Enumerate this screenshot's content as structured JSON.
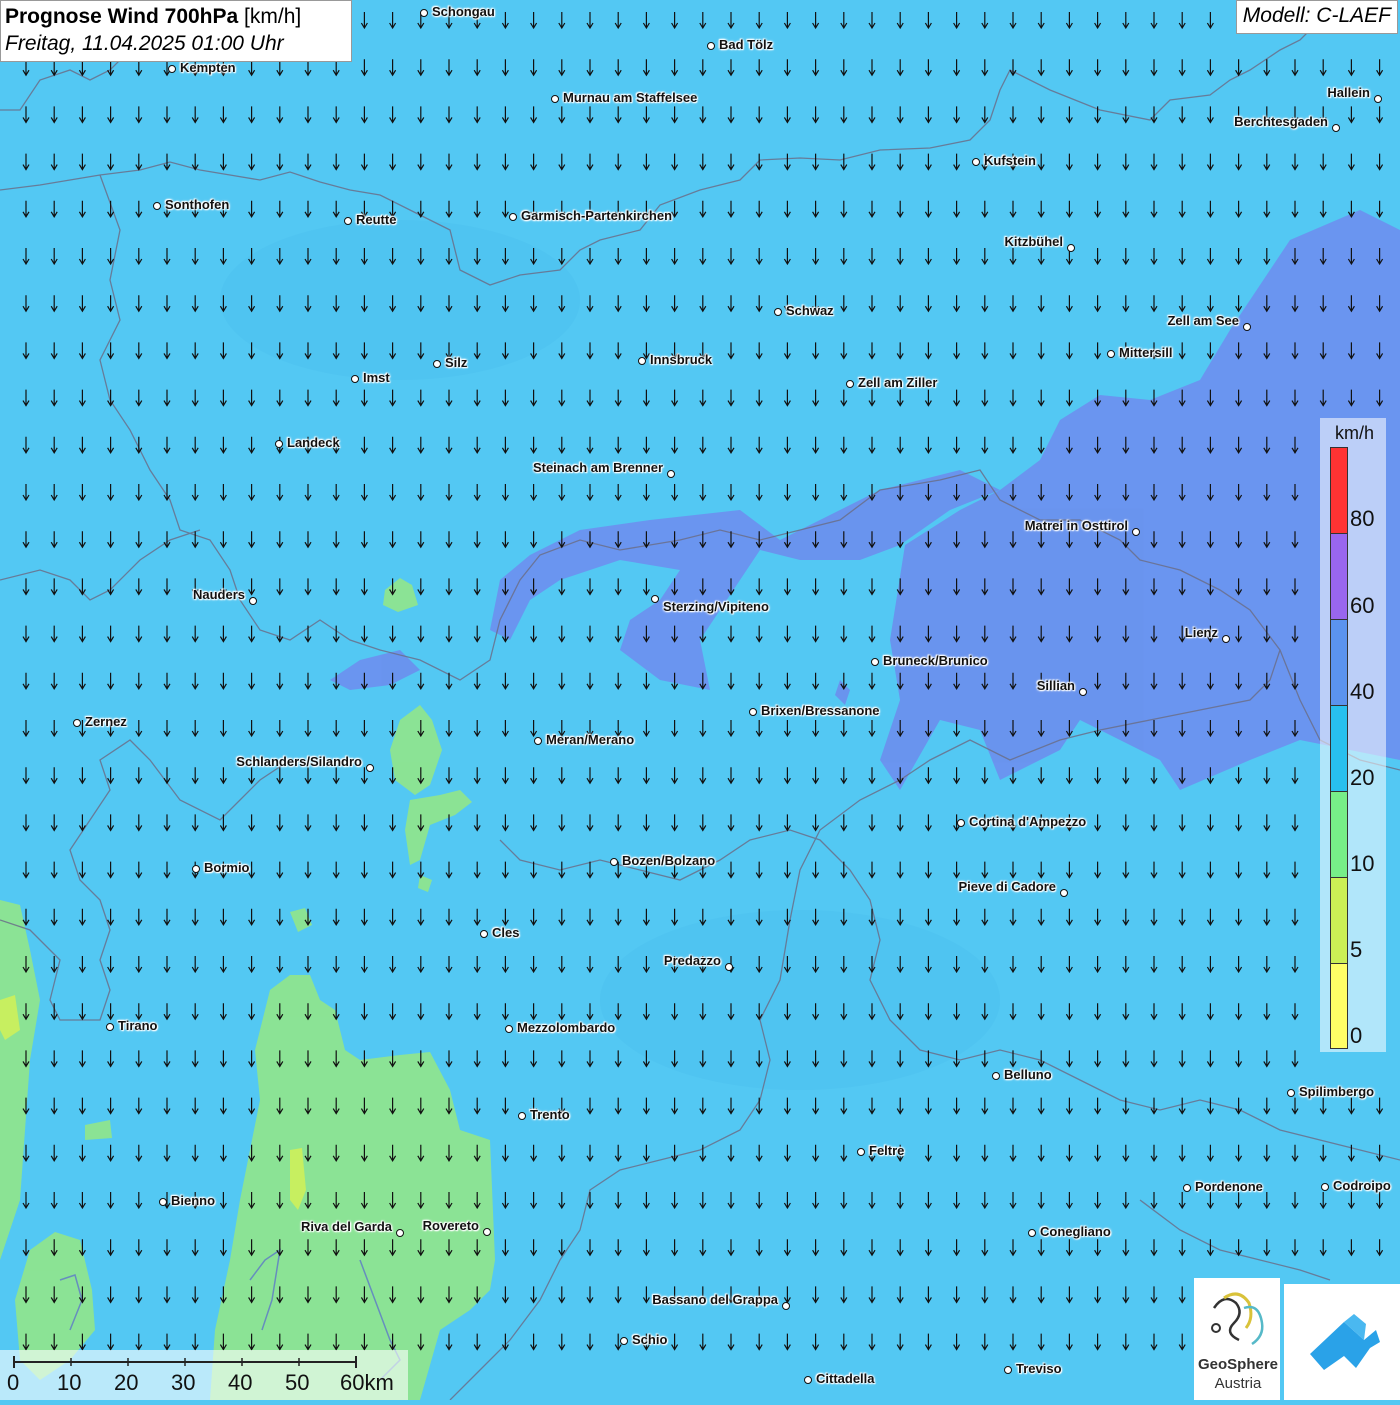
{
  "title": {
    "main": "Prognose Wind 700hPa",
    "unit": "[km/h]",
    "date": "Freitag, 11.04.2025 01:00 Uhr"
  },
  "model": "Modell: C-LAEF",
  "legend": {
    "unit": "km/h",
    "labels": [
      "80",
      "60",
      "40",
      "20",
      "10",
      "5",
      "0"
    ],
    "colors": [
      "#ff3333",
      "#9966ee",
      "#5b93ee",
      "#28c0ee",
      "#77ee88",
      "#ccf055",
      "#ffff66"
    ]
  },
  "scale_bar": {
    "labels": [
      "0",
      "10",
      "20",
      "30",
      "40",
      "50",
      "60km"
    ]
  },
  "wind_direction": "north-to-south",
  "brand": {
    "name": "GeoSphere",
    "sub": "Austria"
  },
  "cities": [
    {
      "name": "Schongau"
    },
    {
      "name": "Bad Tölz"
    },
    {
      "name": "Kempten"
    },
    {
      "name": "Murnau am Staffelsee"
    },
    {
      "name": "Hallein"
    },
    {
      "name": "Berchtesgaden"
    },
    {
      "name": "Kufstein"
    },
    {
      "name": "Sonthofen"
    },
    {
      "name": "Reutte"
    },
    {
      "name": "Garmisch-Partenkirchen"
    },
    {
      "name": "Kitzbühel"
    },
    {
      "name": "Schwaz"
    },
    {
      "name": "Zell am See"
    },
    {
      "name": "Mittersill"
    },
    {
      "name": "Silz"
    },
    {
      "name": "Innsbruck"
    },
    {
      "name": "Imst"
    },
    {
      "name": "Zell am Ziller"
    },
    {
      "name": "Landeck"
    },
    {
      "name": "Steinach am Brenner"
    },
    {
      "name": "Matrei in Osttirol"
    },
    {
      "name": "Nauders"
    },
    {
      "name": "Sterzing/Vipiteno"
    },
    {
      "name": "Lienz"
    },
    {
      "name": "Bruneck/Brunico"
    },
    {
      "name": "Sillian"
    },
    {
      "name": "Brixen/Bressanone"
    },
    {
      "name": "Zernez"
    },
    {
      "name": "Meran/Merano"
    },
    {
      "name": "Schlanders/Silandro"
    },
    {
      "name": "Cortina d'Ampezzo"
    },
    {
      "name": "Bozen/Bolzano"
    },
    {
      "name": "Bormio"
    },
    {
      "name": "Pieve di Cadore"
    },
    {
      "name": "Cles"
    },
    {
      "name": "Predazzo"
    },
    {
      "name": "Tirano"
    },
    {
      "name": "Mezzolombardo"
    },
    {
      "name": "Belluno"
    },
    {
      "name": "Spilimbergo"
    },
    {
      "name": "Trento"
    },
    {
      "name": "Feltre"
    },
    {
      "name": "Bienno"
    },
    {
      "name": "Pordenone"
    },
    {
      "name": "Codroipo"
    },
    {
      "name": "Riva del Garda"
    },
    {
      "name": "Rovereto"
    },
    {
      "name": "Conegliano"
    },
    {
      "name": "Bassano del Grappa"
    },
    {
      "name": "Schio"
    },
    {
      "name": "Treviso"
    },
    {
      "name": "Cittadella"
    }
  ]
}
